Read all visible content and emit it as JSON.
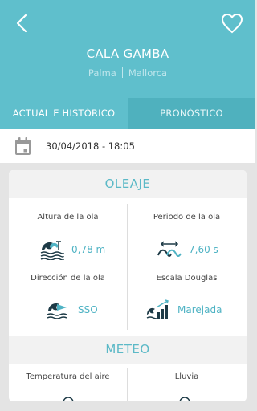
{
  "header": {
    "title": "CALA GAMBA",
    "location_city": "Palma",
    "location_region": "Mallorca",
    "background_color": "#5fbfcc"
  },
  "tabs": [
    {
      "label": "ACTUAL E HISTÓRICO",
      "active": true
    },
    {
      "label": "PRONÓSTICO",
      "active": false
    }
  ],
  "datetime": "30/04/2018 - 18:05",
  "oleaje": {
    "title": "OLEAJE",
    "wave_height": {
      "label": "Altura de la ola",
      "value": "0,78 m"
    },
    "wave_period": {
      "label": "Periodo de la ola",
      "value": "7,60 s"
    },
    "wave_direction": {
      "label": "Dirección de la ola",
      "value": "SSO"
    },
    "douglas_scale": {
      "label": "Escala Douglas",
      "value": "Marejada"
    }
  },
  "meteo": {
    "title": "METEO",
    "air_temperature": {
      "label": "Temperatura del aire"
    },
    "rain": {
      "label": "Lluvia"
    }
  },
  "icons": {
    "back": "chevron-left-icon",
    "favorite": "heart-outline-icon",
    "calendar": "calendar-icon",
    "accent_color": "#4fb3c4",
    "icon_dark": "#1d3a46"
  }
}
